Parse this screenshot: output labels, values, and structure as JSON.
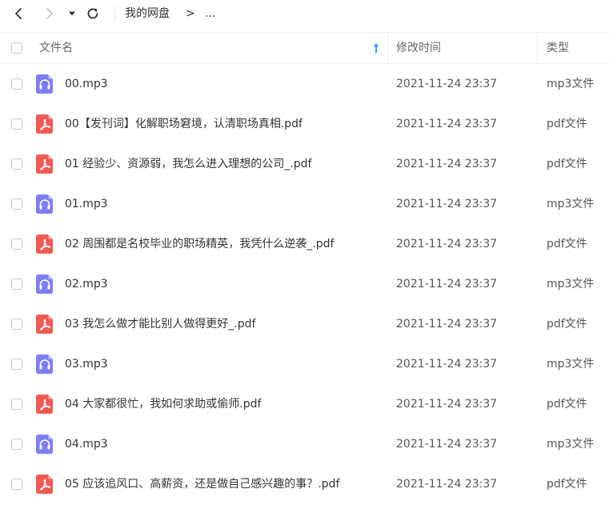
{
  "nav": {
    "breadcrumb_root": "我的网盘",
    "breadcrumb_sep": ">",
    "breadcrumb_more": "..."
  },
  "header": {
    "name_label": "文件名",
    "time_label": "修改时间",
    "type_label": "类型"
  },
  "colors": {
    "pdf_icon": "#f25a55",
    "mp3_icon": "#7d7ef5",
    "sort_arrow": "#3a9cf5"
  },
  "rows": [
    {
      "icon": "headphones-icon",
      "name": "00.mp3",
      "time": "2021-11-24 23:37",
      "type": "mp3文件"
    },
    {
      "icon": "pdf-icon",
      "name": "00【发刊词】化解职场窘境，认清职场真相.pdf",
      "time": "2021-11-24 23:37",
      "type": "pdf文件"
    },
    {
      "icon": "pdf-icon",
      "name": "01 经验少、资源弱，我怎么进入理想的公司_.pdf",
      "time": "2021-11-24 23:37",
      "type": "pdf文件"
    },
    {
      "icon": "headphones-icon",
      "name": "01.mp3",
      "time": "2021-11-24 23:37",
      "type": "mp3文件"
    },
    {
      "icon": "pdf-icon",
      "name": "02 周围都是名校毕业的职场精英，我凭什么逆袭_.pdf",
      "time": "2021-11-24 23:37",
      "type": "pdf文件"
    },
    {
      "icon": "headphones-icon",
      "name": "02.mp3",
      "time": "2021-11-24 23:37",
      "type": "mp3文件"
    },
    {
      "icon": "pdf-icon",
      "name": "03 我怎么做才能比别人做得更好_.pdf",
      "time": "2021-11-24 23:37",
      "type": "pdf文件"
    },
    {
      "icon": "headphones-icon",
      "name": "03.mp3",
      "time": "2021-11-24 23:37",
      "type": "mp3文件"
    },
    {
      "icon": "pdf-icon",
      "name": "04 大家都很忙，我如何求助或偷师.pdf",
      "time": "2021-11-24 23:37",
      "type": "pdf文件"
    },
    {
      "icon": "headphones-icon",
      "name": "04.mp3",
      "time": "2021-11-24 23:37",
      "type": "mp3文件"
    },
    {
      "icon": "pdf-icon",
      "name": "05 应该追风口、高薪资，还是做自己感兴趣的事？.pdf",
      "time": "2021-11-24 23:37",
      "type": "pdf文件"
    }
  ]
}
